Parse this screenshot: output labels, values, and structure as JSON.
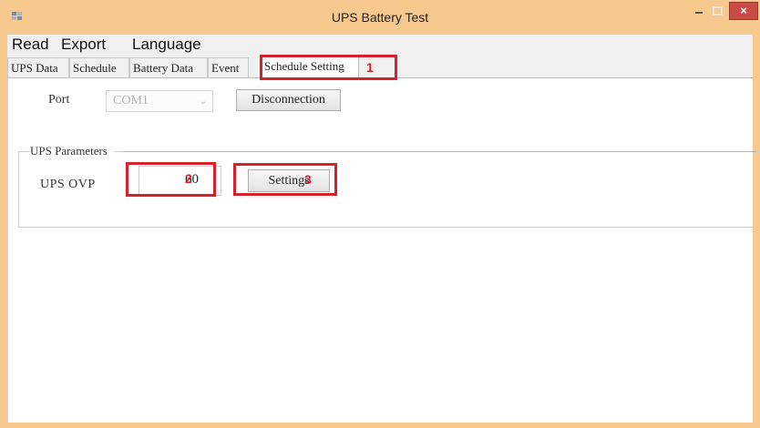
{
  "window": {
    "title": "UPS Battery Test",
    "close_glyph": "×",
    "accent": "#f7c98f",
    "close_color": "#c94b45"
  },
  "menu": {
    "items": [
      "Read",
      "Export",
      "Language"
    ]
  },
  "tabs": [
    {
      "label": "UPS Data"
    },
    {
      "label": "Schedule"
    },
    {
      "label": "Battery Data"
    },
    {
      "label": "Event"
    },
    {
      "label": "Schedule Setting",
      "active": true
    }
  ],
  "port": {
    "label": "Port",
    "value": "COM1",
    "connect_button": "Disconnection"
  },
  "ups_parameters": {
    "title": "UPS Parameters",
    "ovp_label": "UPS OVP",
    "ovp_value": "60",
    "settings_button": "Settings"
  },
  "annotations": {
    "marker_1": "1",
    "marker_2": "2",
    "marker_3": "3",
    "color": "#d8202a"
  }
}
